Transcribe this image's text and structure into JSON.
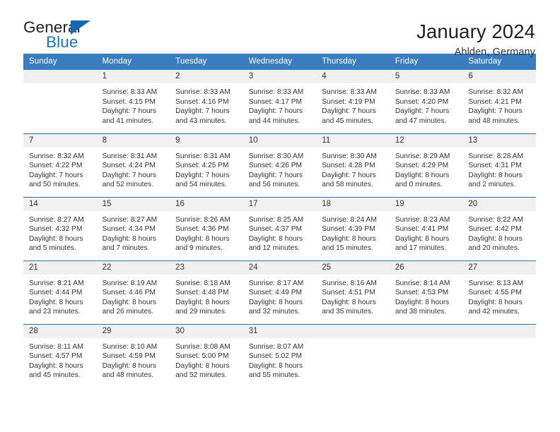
{
  "brand": {
    "name_part1": "General",
    "name_part2": "Blue",
    "triangle_color": "#1667b1",
    "blue_color": "#1b75bb"
  },
  "header": {
    "title": "January 2024",
    "location": "Ahlden, Germany"
  },
  "colors": {
    "header_row_bg": "#3a7dbf",
    "daynum_bg": "#f0f0f0",
    "week_divider": "#2e6da4",
    "text": "#333333"
  },
  "weekday_headers": [
    "Sunday",
    "Monday",
    "Tuesday",
    "Wednesday",
    "Thursday",
    "Friday",
    "Saturday"
  ],
  "weeks": [
    [
      {
        "day": "",
        "sunrise": "",
        "sunset": "",
        "daylight1": "",
        "daylight2": ""
      },
      {
        "day": "1",
        "sunrise": "Sunrise: 8:33 AM",
        "sunset": "Sunset: 4:15 PM",
        "daylight1": "Daylight: 7 hours",
        "daylight2": "and 41 minutes."
      },
      {
        "day": "2",
        "sunrise": "Sunrise: 8:33 AM",
        "sunset": "Sunset: 4:16 PM",
        "daylight1": "Daylight: 7 hours",
        "daylight2": "and 43 minutes."
      },
      {
        "day": "3",
        "sunrise": "Sunrise: 8:33 AM",
        "sunset": "Sunset: 4:17 PM",
        "daylight1": "Daylight: 7 hours",
        "daylight2": "and 44 minutes."
      },
      {
        "day": "4",
        "sunrise": "Sunrise: 8:33 AM",
        "sunset": "Sunset: 4:19 PM",
        "daylight1": "Daylight: 7 hours",
        "daylight2": "and 45 minutes."
      },
      {
        "day": "5",
        "sunrise": "Sunrise: 8:33 AM",
        "sunset": "Sunset: 4:20 PM",
        "daylight1": "Daylight: 7 hours",
        "daylight2": "and 47 minutes."
      },
      {
        "day": "6",
        "sunrise": "Sunrise: 8:32 AM",
        "sunset": "Sunset: 4:21 PM",
        "daylight1": "Daylight: 7 hours",
        "daylight2": "and 48 minutes."
      }
    ],
    [
      {
        "day": "7",
        "sunrise": "Sunrise: 8:32 AM",
        "sunset": "Sunset: 4:22 PM",
        "daylight1": "Daylight: 7 hours",
        "daylight2": "and 50 minutes."
      },
      {
        "day": "8",
        "sunrise": "Sunrise: 8:31 AM",
        "sunset": "Sunset: 4:24 PM",
        "daylight1": "Daylight: 7 hours",
        "daylight2": "and 52 minutes."
      },
      {
        "day": "9",
        "sunrise": "Sunrise: 8:31 AM",
        "sunset": "Sunset: 4:25 PM",
        "daylight1": "Daylight: 7 hours",
        "daylight2": "and 54 minutes."
      },
      {
        "day": "10",
        "sunrise": "Sunrise: 8:30 AM",
        "sunset": "Sunset: 4:26 PM",
        "daylight1": "Daylight: 7 hours",
        "daylight2": "and 56 minutes."
      },
      {
        "day": "11",
        "sunrise": "Sunrise: 8:30 AM",
        "sunset": "Sunset: 4:28 PM",
        "daylight1": "Daylight: 7 hours",
        "daylight2": "and 58 minutes."
      },
      {
        "day": "12",
        "sunrise": "Sunrise: 8:29 AM",
        "sunset": "Sunset: 4:29 PM",
        "daylight1": "Daylight: 8 hours",
        "daylight2": "and 0 minutes."
      },
      {
        "day": "13",
        "sunrise": "Sunrise: 8:28 AM",
        "sunset": "Sunset: 4:31 PM",
        "daylight1": "Daylight: 8 hours",
        "daylight2": "and 2 minutes."
      }
    ],
    [
      {
        "day": "14",
        "sunrise": "Sunrise: 8:27 AM",
        "sunset": "Sunset: 4:32 PM",
        "daylight1": "Daylight: 8 hours",
        "daylight2": "and 5 minutes."
      },
      {
        "day": "15",
        "sunrise": "Sunrise: 8:27 AM",
        "sunset": "Sunset: 4:34 PM",
        "daylight1": "Daylight: 8 hours",
        "daylight2": "and 7 minutes."
      },
      {
        "day": "16",
        "sunrise": "Sunrise: 8:26 AM",
        "sunset": "Sunset: 4:36 PM",
        "daylight1": "Daylight: 8 hours",
        "daylight2": "and 9 minutes."
      },
      {
        "day": "17",
        "sunrise": "Sunrise: 8:25 AM",
        "sunset": "Sunset: 4:37 PM",
        "daylight1": "Daylight: 8 hours",
        "daylight2": "and 12 minutes."
      },
      {
        "day": "18",
        "sunrise": "Sunrise: 8:24 AM",
        "sunset": "Sunset: 4:39 PM",
        "daylight1": "Daylight: 8 hours",
        "daylight2": "and 15 minutes."
      },
      {
        "day": "19",
        "sunrise": "Sunrise: 8:23 AM",
        "sunset": "Sunset: 4:41 PM",
        "daylight1": "Daylight: 8 hours",
        "daylight2": "and 17 minutes."
      },
      {
        "day": "20",
        "sunrise": "Sunrise: 8:22 AM",
        "sunset": "Sunset: 4:42 PM",
        "daylight1": "Daylight: 8 hours",
        "daylight2": "and 20 minutes."
      }
    ],
    [
      {
        "day": "21",
        "sunrise": "Sunrise: 8:21 AM",
        "sunset": "Sunset: 4:44 PM",
        "daylight1": "Daylight: 8 hours",
        "daylight2": "and 23 minutes."
      },
      {
        "day": "22",
        "sunrise": "Sunrise: 8:19 AM",
        "sunset": "Sunset: 4:46 PM",
        "daylight1": "Daylight: 8 hours",
        "daylight2": "and 26 minutes."
      },
      {
        "day": "23",
        "sunrise": "Sunrise: 8:18 AM",
        "sunset": "Sunset: 4:48 PM",
        "daylight1": "Daylight: 8 hours",
        "daylight2": "and 29 minutes."
      },
      {
        "day": "24",
        "sunrise": "Sunrise: 8:17 AM",
        "sunset": "Sunset: 4:49 PM",
        "daylight1": "Daylight: 8 hours",
        "daylight2": "and 32 minutes."
      },
      {
        "day": "25",
        "sunrise": "Sunrise: 8:16 AM",
        "sunset": "Sunset: 4:51 PM",
        "daylight1": "Daylight: 8 hours",
        "daylight2": "and 35 minutes."
      },
      {
        "day": "26",
        "sunrise": "Sunrise: 8:14 AM",
        "sunset": "Sunset: 4:53 PM",
        "daylight1": "Daylight: 8 hours",
        "daylight2": "and 38 minutes."
      },
      {
        "day": "27",
        "sunrise": "Sunrise: 8:13 AM",
        "sunset": "Sunset: 4:55 PM",
        "daylight1": "Daylight: 8 hours",
        "daylight2": "and 42 minutes."
      }
    ],
    [
      {
        "day": "28",
        "sunrise": "Sunrise: 8:11 AM",
        "sunset": "Sunset: 4:57 PM",
        "daylight1": "Daylight: 8 hours",
        "daylight2": "and 45 minutes."
      },
      {
        "day": "29",
        "sunrise": "Sunrise: 8:10 AM",
        "sunset": "Sunset: 4:59 PM",
        "daylight1": "Daylight: 8 hours",
        "daylight2": "and 48 minutes."
      },
      {
        "day": "30",
        "sunrise": "Sunrise: 8:08 AM",
        "sunset": "Sunset: 5:00 PM",
        "daylight1": "Daylight: 8 hours",
        "daylight2": "and 52 minutes."
      },
      {
        "day": "31",
        "sunrise": "Sunrise: 8:07 AM",
        "sunset": "Sunset: 5:02 PM",
        "daylight1": "Daylight: 8 hours",
        "daylight2": "and 55 minutes."
      },
      {
        "day": "",
        "sunrise": "",
        "sunset": "",
        "daylight1": "",
        "daylight2": ""
      },
      {
        "day": "",
        "sunrise": "",
        "sunset": "",
        "daylight1": "",
        "daylight2": ""
      },
      {
        "day": "",
        "sunrise": "",
        "sunset": "",
        "daylight1": "",
        "daylight2": ""
      }
    ]
  ]
}
